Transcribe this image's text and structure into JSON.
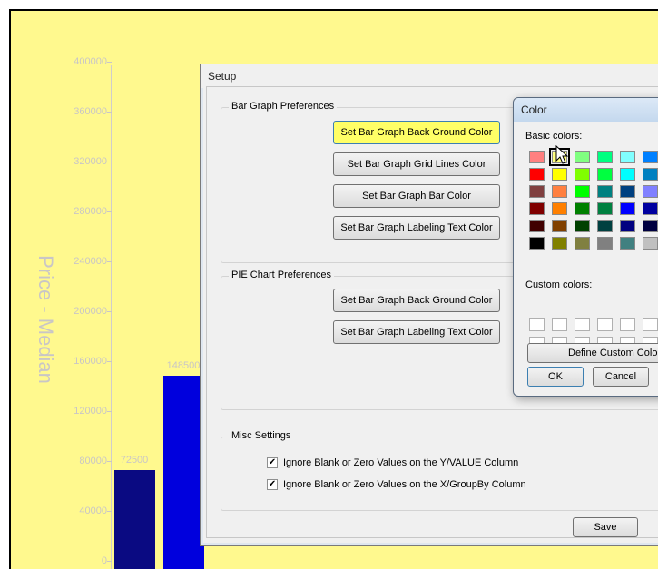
{
  "chart": {
    "ylabel": "Price - Median",
    "yticks": [
      "400000",
      "360000",
      "320000",
      "280000",
      "240000",
      "200000",
      "160000",
      "120000",
      "80000",
      "40000",
      "0"
    ],
    "bar_labels": [
      "72500",
      "148500"
    ]
  },
  "chart_data": {
    "type": "bar",
    "ylabel": "Price - Median",
    "ylim": [
      0,
      400000
    ],
    "values": [
      72500,
      148500
    ],
    "colors": [
      "#0a0a82",
      "#0000dd"
    ]
  },
  "setup": {
    "title": "Setup",
    "bar_group_title": "Bar Graph Preferences",
    "bar_buttons": [
      "Set Bar Graph Back Ground Color",
      "Set Bar Graph Grid Lines Color",
      "Set Bar Graph Bar Color",
      "Set Bar Graph Labeling Text Color"
    ],
    "pie_group_title": "PIE Chart Preferences",
    "pie_buttons": [
      "Set Bar Graph Back Ground Color",
      "Set Bar Graph Labeling Text Color"
    ],
    "misc_group_title": "Misc Settings",
    "check_y": "Ignore Blank or Zero Values on the Y/VALUE Column",
    "check_x": "Ignore Blank or Zero Values on the X/GroupBy Column",
    "save_label": "Save"
  },
  "color_dialog": {
    "title": "Color",
    "basic_label": "Basic colors:",
    "custom_label": "Custom colors:",
    "define_label": "Define Custom Colors",
    "ok_label": "OK",
    "cancel_label": "Cancel",
    "basic_colors": [
      "#ff8080",
      "#ffff80",
      "#80ff80",
      "#00ff80",
      "#80ffff",
      "#0080ff",
      "#ff0000",
      "#ffff00",
      "#80ff00",
      "#00ff40",
      "#00ffff",
      "#0080c0",
      "#804040",
      "#ff8040",
      "#00ff00",
      "#008080",
      "#004080",
      "#8080ff",
      "#800000",
      "#ff8000",
      "#008000",
      "#008040",
      "#0000ff",
      "#0000a0",
      "#400000",
      "#804000",
      "#004000",
      "#004040",
      "#000080",
      "#000040",
      "#000000",
      "#808000",
      "#808040",
      "#808080",
      "#408080",
      "#c0c0c0"
    ]
  }
}
